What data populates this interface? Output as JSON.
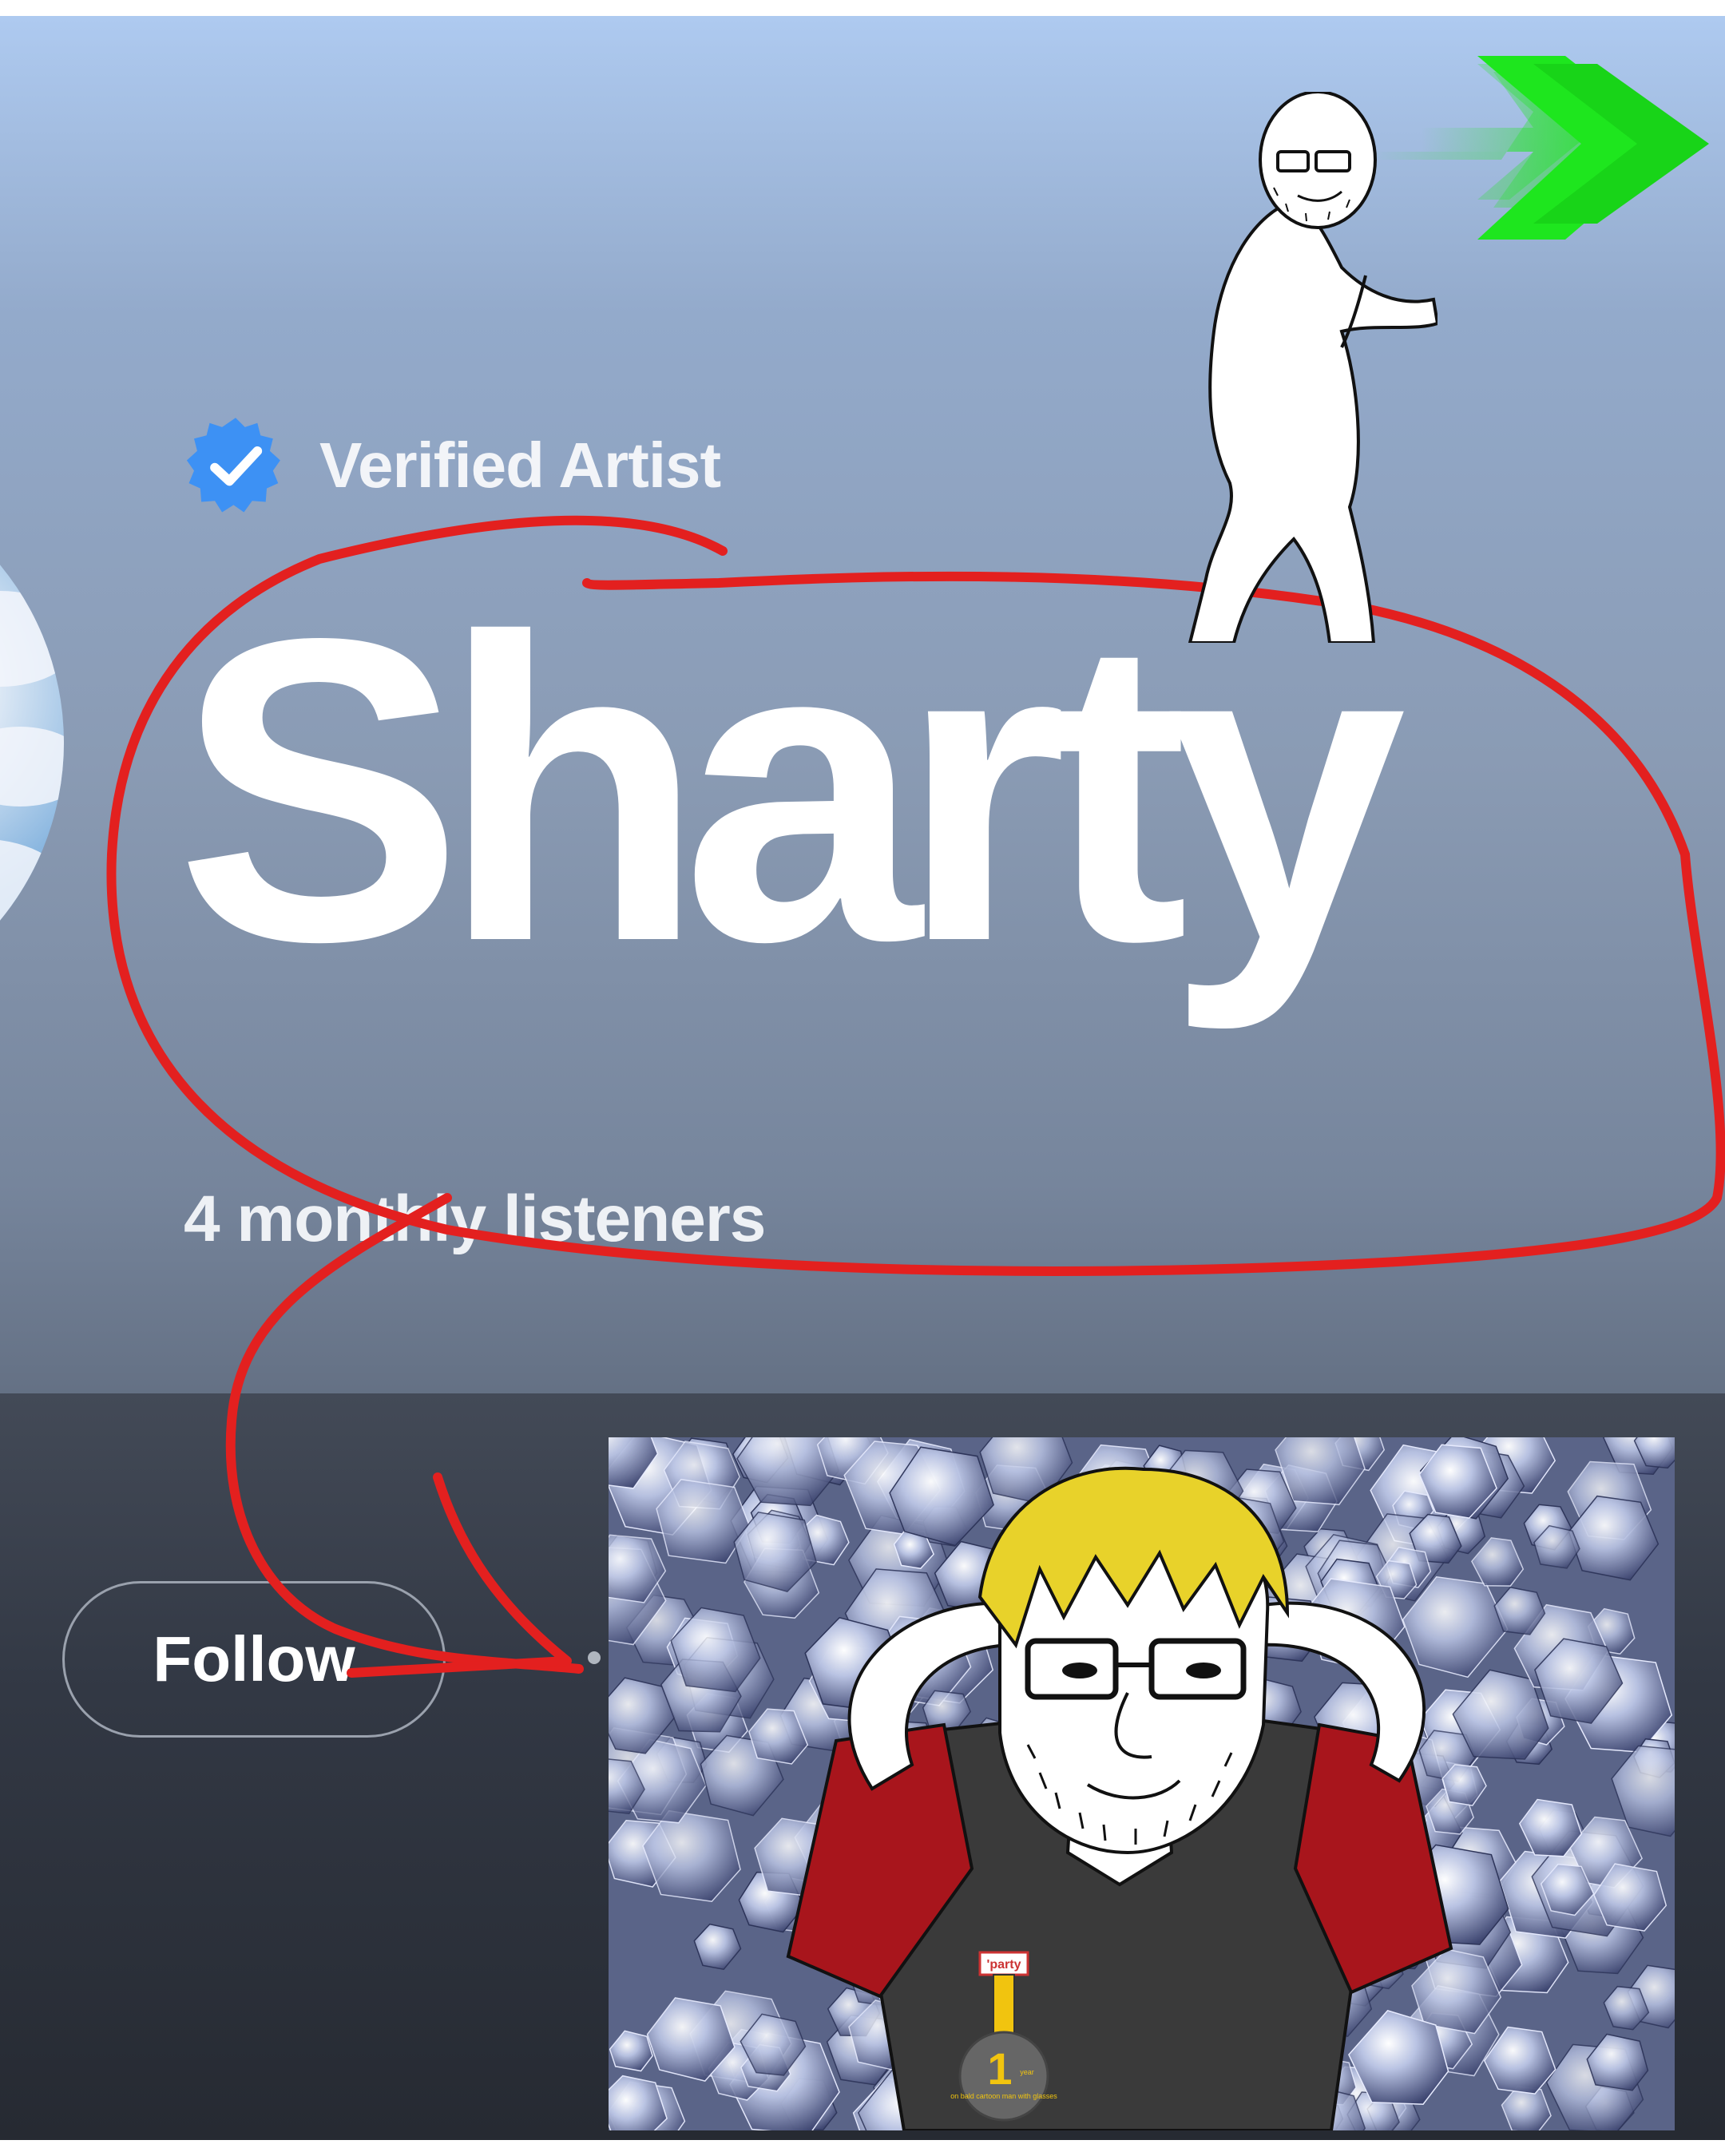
{
  "artist_page": {
    "verified_label": "Verified Artist",
    "artist_name": "Sharty",
    "monthly_listeners": "4 monthly listeners",
    "follow_label": "Follow"
  },
  "medal": {
    "ribbon_text": "'party",
    "number": "1",
    "unit": "year",
    "caption": "on bald cartoon man with glasses"
  },
  "colors": {
    "verified_badge": "#3d91f4",
    "scribble": "#e3201f",
    "arrow_green": "#1ee61e",
    "hair": "#e8d22a",
    "shirt": "#3a3a3a",
    "sleeves": "#a8151c"
  },
  "icons": {
    "verified": "check-badge-icon"
  }
}
